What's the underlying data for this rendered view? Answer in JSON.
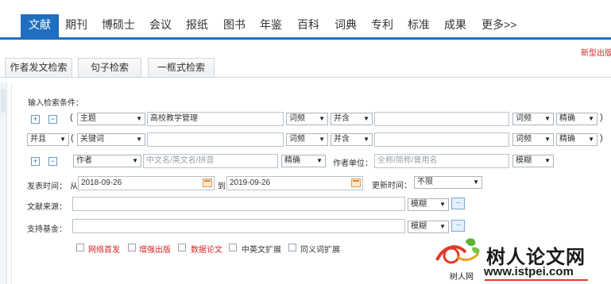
{
  "nav": {
    "items": [
      "文献",
      "期刊",
      "博硕士",
      "会议",
      "报纸",
      "图书",
      "年鉴",
      "百科",
      "词典",
      "专利",
      "标准",
      "成果",
      "更多>>"
    ],
    "active": "文献",
    "accent": "#1e6fc0"
  },
  "banner": {
    "new_type": "新型出版"
  },
  "tabs": [
    "作者发文检索",
    "句子检索",
    "一框式检索"
  ],
  "form": {
    "heading": "输入检索条件：",
    "row1": {
      "field": "主题",
      "value": "高校教学管理",
      "freq1": "词频",
      "logic": "并含",
      "freq2": "词频",
      "match": "精确"
    },
    "row2": {
      "bool": "并且",
      "field": "关键词",
      "value": "",
      "freq1": "词频",
      "logic": "并含",
      "freq2": "词频",
      "match": "精确"
    },
    "row3": {
      "field": "作者",
      "placeholder": "中文名/英文名/拼音",
      "match": "精确",
      "unit_label": "作者单位：",
      "unit_placeholder": "全称/简称/曾用名",
      "unit_match": "模糊"
    },
    "date": {
      "label": "发表时间：",
      "from": "从",
      "from_value": "2018-09-26",
      "to": "到",
      "to_value": "2019-09-26",
      "update_label": "更新时间：",
      "update_value": "不限"
    },
    "source": {
      "label": "文献来源：",
      "match": "模糊"
    },
    "fund": {
      "label": "支持基金：",
      "match": "模糊"
    },
    "checkboxes": [
      {
        "label": "网络首发",
        "color": "red"
      },
      {
        "label": "增强出版",
        "color": "red"
      },
      {
        "label": "数据论文",
        "color": "red"
      },
      {
        "label": "中英文扩展",
        "color": "normal"
      },
      {
        "label": "同义词扩展",
        "color": "normal"
      }
    ],
    "plus": "+",
    "minus": "−",
    "open_paren": "(",
    "close_paren": ")",
    "more_dots": "···"
  },
  "watermark": {
    "title": "树人论文网",
    "url": "www.istpei.com",
    "small": "树人网"
  }
}
